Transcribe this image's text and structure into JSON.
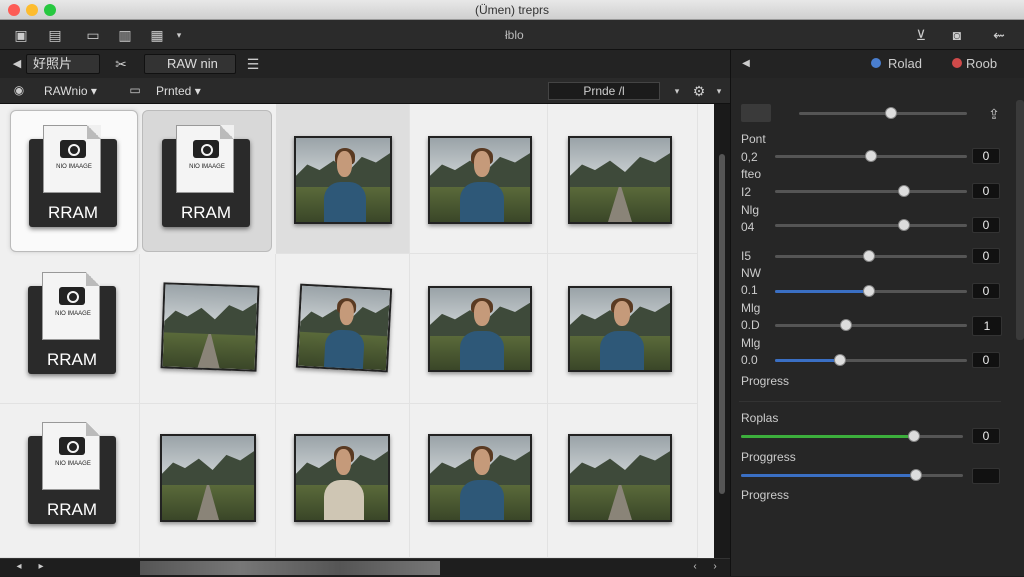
{
  "window": {
    "title": "(Ümen) treprs"
  },
  "toolbar1": {
    "center_label": "łblo"
  },
  "toolbar2": {
    "tab_label": "好照片",
    "raw_label": "RAW nin",
    "legend": [
      {
        "label": "Rolad",
        "color": "#4a7fd0"
      },
      {
        "label": "Roob",
        "color": "#d04a4a"
      }
    ]
  },
  "toolbar3": {
    "sort_label": "RAWnio ▾",
    "filter_label": "Prnted ▾",
    "search_value": "Prnde /l"
  },
  "grid": {
    "raw_caption": "RRAM",
    "raw_small": "NIO IMAAGE"
  },
  "panel": {
    "labels": [
      "Pont",
      "0,2",
      "fteo",
      "I2",
      "Nlg",
      "04",
      "I5",
      "NW",
      "0.1",
      "Mlg",
      "0.D",
      "Mlg",
      "0.0",
      "Progress",
      "Roplas",
      "Proggress",
      "Progress"
    ],
    "sliders": [
      {
        "value": 0.55
      },
      {
        "value": 0.5,
        "box": "0"
      },
      {
        "value": 0.67,
        "box": "0"
      },
      {
        "value": 0.67,
        "box": "0"
      },
      {
        "value": 0.49,
        "box": "0"
      },
      {
        "value": 0.49,
        "box": "0",
        "fill_color": "#3a6fc4"
      },
      {
        "value": 0.37,
        "box": "1"
      },
      {
        "value": 0.34,
        "box": "0",
        "fill_color": "#3a6fc4"
      },
      {
        "value": 0.78,
        "box": "0",
        "fill_color": "#3cae3c"
      },
      {
        "value": 0.79,
        "box": "",
        "fill_color": "#3a6fc4"
      }
    ]
  }
}
